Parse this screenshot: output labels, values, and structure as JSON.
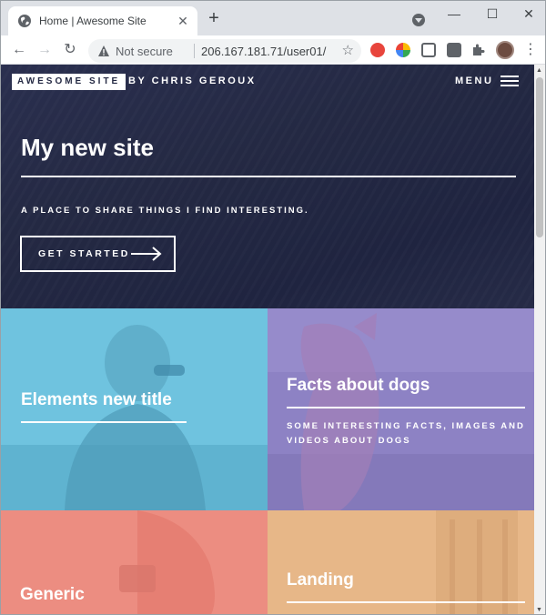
{
  "browser": {
    "tab_title": "Home | Awesome Site",
    "tab_close": "✕",
    "new_tab": "+",
    "window_controls": {
      "minimize": "—",
      "maximize": "☐",
      "close": "✕"
    },
    "nav": {
      "back": "←",
      "forward": "→",
      "reload": "↻"
    },
    "security_label": "Not secure",
    "url": "206.167.181.71/user01/",
    "bookmark_star": "☆",
    "menu_dots": "⋮",
    "scroll_up": "▲",
    "scroll_down": "▼"
  },
  "site": {
    "logo_name": "AWESOME SITE",
    "logo_author": "BY CHRIS GEROUX",
    "menu_label": "MENU",
    "title": "My new site",
    "tagline": "A PLACE TO SHARE THINGS I FIND INTERESTING.",
    "cta_label": "GET STARTED"
  },
  "tiles": [
    {
      "title": "Elements new title",
      "description": "",
      "color": "#6fc3df"
    },
    {
      "title": "Facts about dogs",
      "description": "SOME INTERESTING FACTS, IMAGES AND VIDEOS ABOUT DOGS",
      "color": "#8d82c4"
    },
    {
      "title": "Generic",
      "description": "",
      "color": "#ec8d81"
    },
    {
      "title": "Landing",
      "description": "",
      "color": "#e7b788"
    }
  ],
  "colors": {
    "banner": "#242943",
    "text": "#ffffff",
    "chrome_tabstrip": "#dee1e6"
  }
}
